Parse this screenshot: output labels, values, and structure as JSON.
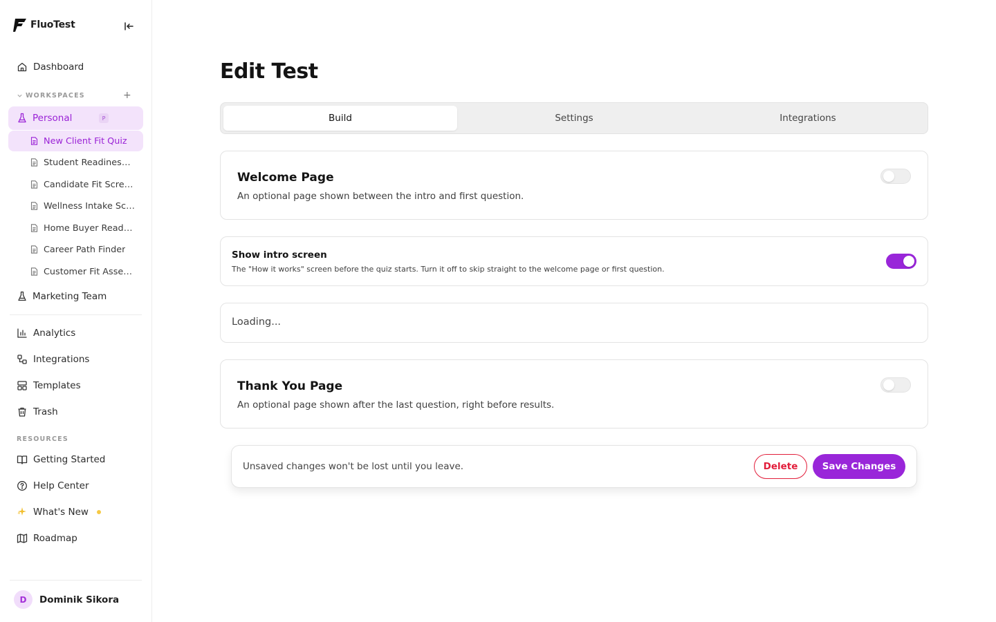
{
  "brand": {
    "name": "FluoTest"
  },
  "sidebar": {
    "dashboard": "Dashboard",
    "workspaces_label": "WORKSPACES",
    "workspaces_add": "+",
    "personal": {
      "label": "Personal",
      "badge": "P"
    },
    "tests": [
      "New Client Fit Quiz",
      "Student Readiness Quiz",
      "Candidate Fit Screener",
      "Wellness Intake Screener",
      "Home Buyer Readiness Quiz",
      "Career Path Finder",
      "Customer Fit Assessment"
    ],
    "marketing": "Marketing Team",
    "main_nav": [
      "Analytics",
      "Integrations",
      "Templates",
      "Trash"
    ],
    "resources_label": "RESOURCES",
    "resources": [
      "Getting Started",
      "Help Center",
      "What's New",
      "Roadmap"
    ],
    "user": {
      "initial": "D",
      "name": "Dominik Sikora"
    }
  },
  "main": {
    "title": "Edit Test",
    "tabs": [
      "Build",
      "Settings",
      "Integrations"
    ],
    "active_tab": "Build",
    "welcome": {
      "title": "Welcome Page",
      "description": "An optional page shown between the intro and first question.",
      "enabled": false
    },
    "intro": {
      "title": "Show intro screen",
      "description": "The \"How it works\" screen before the quiz starts. Turn it off to skip straight to the welcome page or first question.",
      "enabled": true
    },
    "loading": "Loading...",
    "thankyou": {
      "title": "Thank You Page",
      "description": "An optional page shown after the last question, right before results.",
      "enabled": false
    }
  },
  "savebar": {
    "message": "Unsaved changes won't be lost until you leave.",
    "delete_label": "Delete",
    "save_label": "Save Changes"
  },
  "colors": {
    "accent": "#9926d9",
    "accent_light": "#f3e3fb",
    "danger": "#e21d3a",
    "new_dot": "#f6c945"
  }
}
